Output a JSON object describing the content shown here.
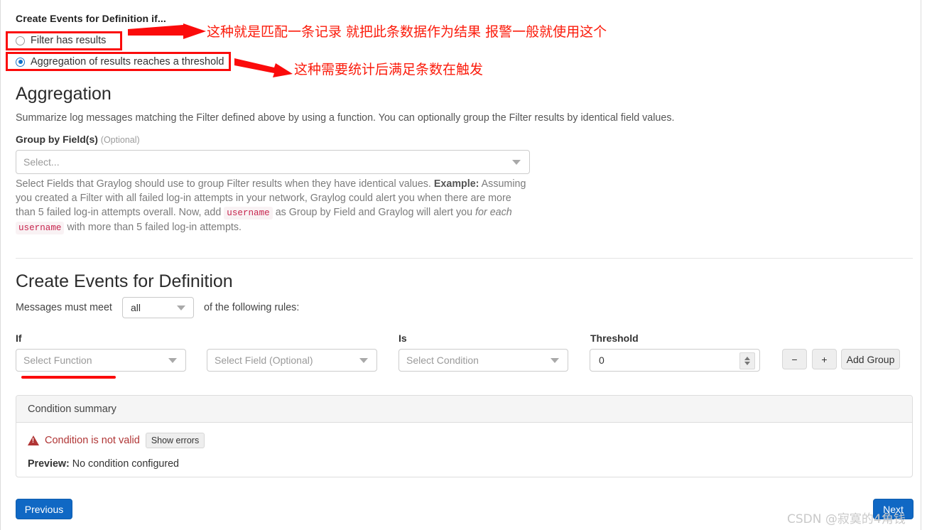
{
  "page": {
    "top_section_title": "Create Events for Definition if...",
    "radio_options": [
      {
        "label": "Filter has results",
        "selected": false
      },
      {
        "label": "Aggregation of results reaches a threshold",
        "selected": true
      }
    ]
  },
  "aggregation": {
    "heading": "Aggregation",
    "description": "Summarize log messages matching the Filter defined above by using a function. You can optionally group the Filter results by identical field values.",
    "group_by_label": "Group by Field(s)",
    "group_by_optional": "(Optional)",
    "group_by_placeholder": "Select...",
    "help": {
      "line1_a": "Select Fields that Graylog should use to group Filter results when they have identical values. ",
      "line1_bold": "Example:",
      "line2": "Assuming you created a Filter with all failed log-in attempts in your network, Graylog could alert you when",
      "line3_a": "there are more than 5 failed log-in attempts overall. Now, add ",
      "line3_code": "username",
      "line3_b": " as Group by Field and Graylog will",
      "line4_a": "alert you ",
      "line4_italic": "for each",
      "line4_code": "username",
      "line4_b": " with more than 5 failed log-in attempts."
    }
  },
  "events": {
    "heading": "Create Events for Definition",
    "messages_prefix": "Messages must meet",
    "match_value": "all",
    "messages_suffix": "of the following rules:",
    "columns": {
      "if_label": "If",
      "is_label": "Is",
      "threshold_label": "Threshold"
    },
    "fields": {
      "function_placeholder": "Select Function",
      "field_placeholder": "Select Field (Optional)",
      "condition_placeholder": "Select Condition",
      "threshold_value": "0"
    },
    "buttons": {
      "remove": "−",
      "add": "+",
      "add_group": "Add Group"
    }
  },
  "summary": {
    "panel_title": "Condition summary",
    "invalid_text": "Condition is not valid",
    "show_errors": "Show errors",
    "preview_label": "Preview:",
    "preview_value": "No condition configured"
  },
  "footer": {
    "previous": "Previous",
    "next": "Next"
  },
  "annotations": {
    "note_1": "这种就是匹配一条记录 就把此条数据作为结果 报警一般就使用这个",
    "note_2": "这种需要统计后满足条数在触发"
  },
  "watermark": {
    "text": "CSDN @寂寞的4角钱"
  },
  "colors": {
    "annotation_red": "#fb1b0b",
    "primary_blue": "#1068c4",
    "danger_red": "#b03535",
    "code_pink": "#c7254e"
  }
}
